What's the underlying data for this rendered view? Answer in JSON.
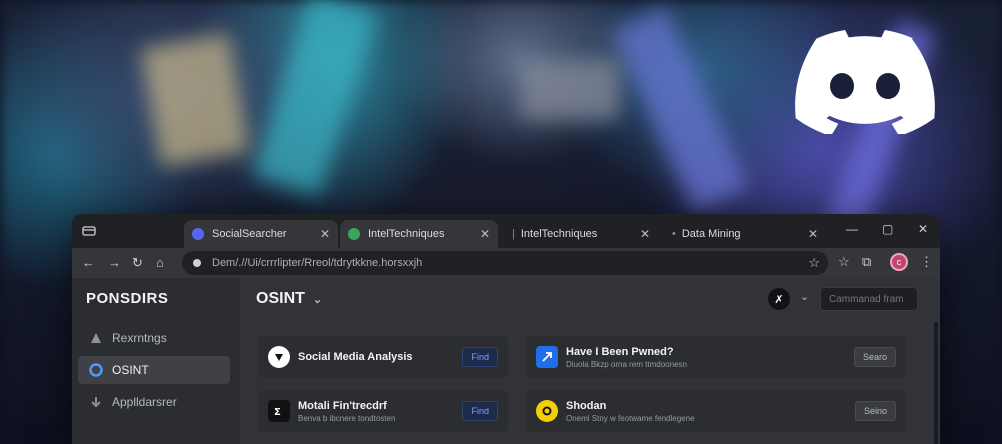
{
  "browser": {
    "tabs": [
      {
        "title": "SocialSearcher",
        "favicon_color": "#5865f2",
        "active": true
      },
      {
        "title": "IntelTechniques",
        "favicon_color": "#3ba55d",
        "active": true
      },
      {
        "title": "IntelTechniques",
        "favicon_color": "",
        "active": false
      },
      {
        "title": "Data Mining",
        "favicon_color": "",
        "active": false
      }
    ],
    "url": "Dem/.//Ui/crrrlipter/Rreol/tdrytkkne.horsxxjh",
    "controls": {
      "minimize": "—",
      "maximize": "▢",
      "close": "✕"
    }
  },
  "sidebar": {
    "brand": "PONSDIRS",
    "items": [
      {
        "label": "Rexrntngs",
        "icon": "triangle-icon",
        "active": false
      },
      {
        "label": "OSINT",
        "icon": "circle-icon",
        "active": true
      },
      {
        "label": "Applldarsrer",
        "icon": "arrow-down-icon",
        "active": false
      }
    ]
  },
  "main": {
    "title": "OSINT",
    "search_placeholder": "Cammanad fram",
    "cards": [
      {
        "name": "Social Media Analysis",
        "desc": "",
        "button": "Find",
        "logo_color": "#ffffff",
        "button_style": "primary"
      },
      {
        "name": "Have I Been Pwned?",
        "desc": "Diuola Bkzp orna rem ttmdoonesn",
        "button": "Searo",
        "logo_color": "#1f6feb",
        "button_style": "secondary"
      },
      {
        "name": "Motali Fin'trecdrf",
        "desc": "Benva b ibcnere tondtosten",
        "button": "Find",
        "logo_color": "#111111",
        "button_style": "primary"
      },
      {
        "name": "Shodan",
        "desc": "Oneml Stny w feotwame fendlegene",
        "button": "Seino",
        "logo_color": "#f0d000",
        "button_style": "secondary"
      }
    ]
  },
  "colors": {
    "accent": "#5865f2",
    "background": "#313338"
  }
}
